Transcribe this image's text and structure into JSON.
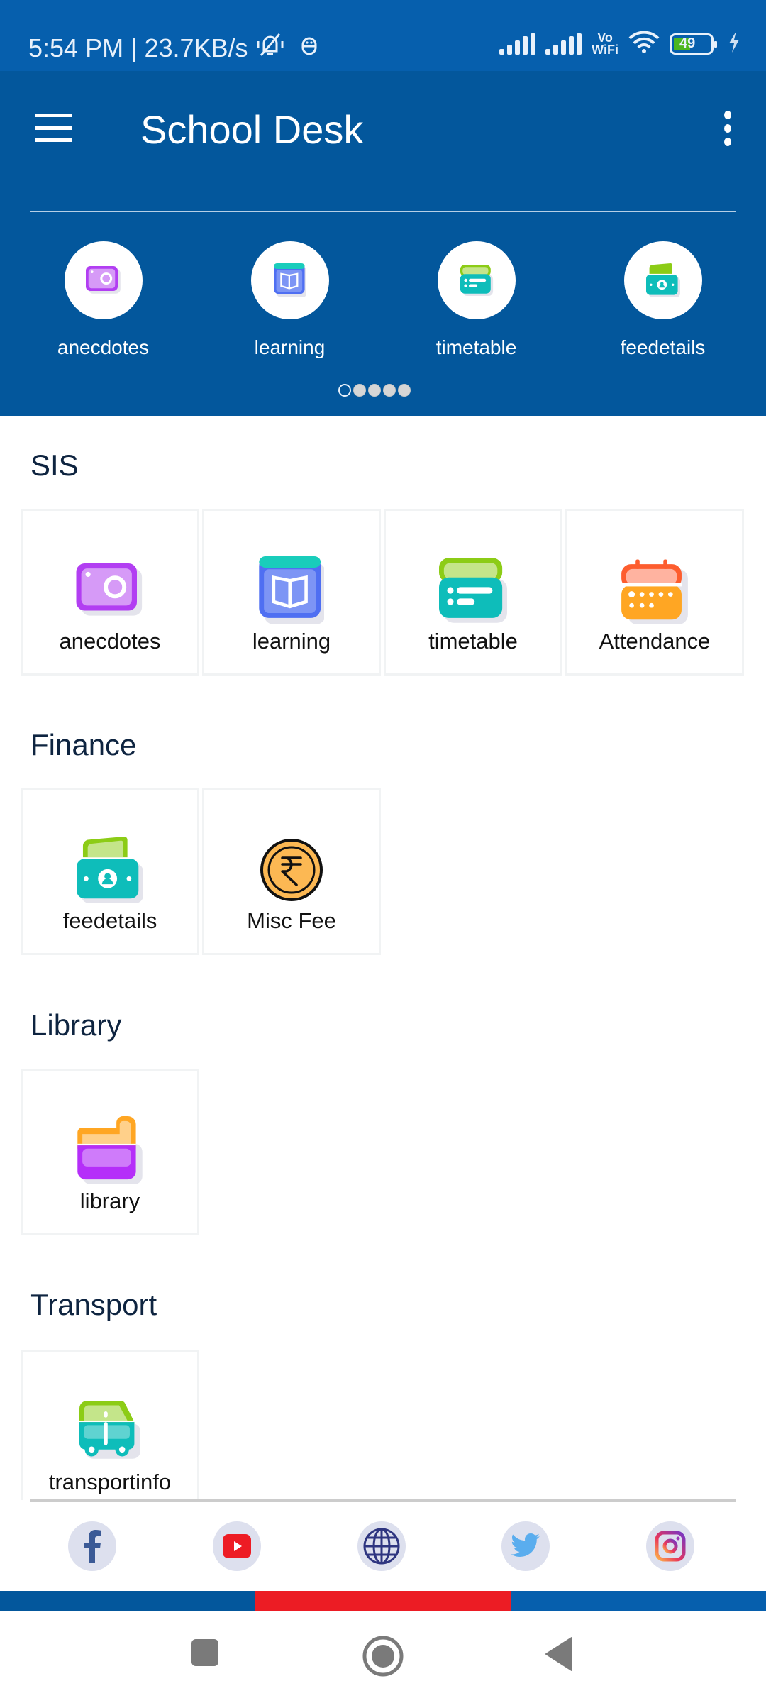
{
  "status_bar": {
    "time": "5:54 PM",
    "separator": "|",
    "net_speed": "23.7KB/s",
    "vowifi_top": "Vo",
    "vowifi_bottom": "WiFi",
    "battery_level": "49",
    "icons": [
      "mute-bell-icon",
      "robot-icon",
      "signal-icon",
      "signal-icon",
      "vowifi-icon",
      "wifi-icon",
      "battery-icon",
      "charging-icon"
    ]
  },
  "app_bar": {
    "title": "School Desk",
    "menu_icon": "hamburger-menu-icon",
    "more_icon": "more-vertical-icon"
  },
  "quick_access": {
    "items": [
      {
        "label": "anecdotes",
        "icon": "camera-icon"
      },
      {
        "label": "learning",
        "icon": "book-icon"
      },
      {
        "label": "timetable",
        "icon": "timetable-icon"
      },
      {
        "label": "feedetails",
        "icon": "money-icon"
      }
    ],
    "pager": {
      "total_pages": 5,
      "active_page": 1
    }
  },
  "sections": [
    {
      "title": "SIS",
      "items": [
        {
          "label": "anecdotes",
          "icon": "camera-icon"
        },
        {
          "label": "learning",
          "icon": "book-icon"
        },
        {
          "label": "timetable",
          "icon": "timetable-icon"
        },
        {
          "label": "Attendance",
          "icon": "calendar-icon"
        }
      ]
    },
    {
      "title": "Finance",
      "items": [
        {
          "label": "feedetails",
          "icon": "money-icon"
        },
        {
          "label": "Misc Fee",
          "icon": "rupee-coin-icon"
        }
      ]
    },
    {
      "title": "Library",
      "items": [
        {
          "label": "library",
          "icon": "folder-icon"
        }
      ]
    },
    {
      "title": "Transport",
      "items": [
        {
          "label": "transportinfo",
          "icon": "bus-icon"
        }
      ]
    }
  ],
  "social_links": [
    {
      "name": "facebook",
      "icon": "facebook-icon"
    },
    {
      "name": "youtube",
      "icon": "youtube-icon"
    },
    {
      "name": "website",
      "icon": "globe-icon"
    },
    {
      "name": "twitter",
      "icon": "twitter-icon"
    },
    {
      "name": "instagram",
      "icon": "instagram-icon"
    }
  ],
  "colors": {
    "status_bar": "#065fad",
    "app_bar": "#03579c",
    "section_title": "#0e2440",
    "accent_blue": "#03579c",
    "accent_red": "#ec1c24",
    "social_bg": "#dde0ee"
  },
  "nav_bar": {
    "buttons": [
      "recents-icon",
      "home-icon",
      "back-icon"
    ]
  }
}
